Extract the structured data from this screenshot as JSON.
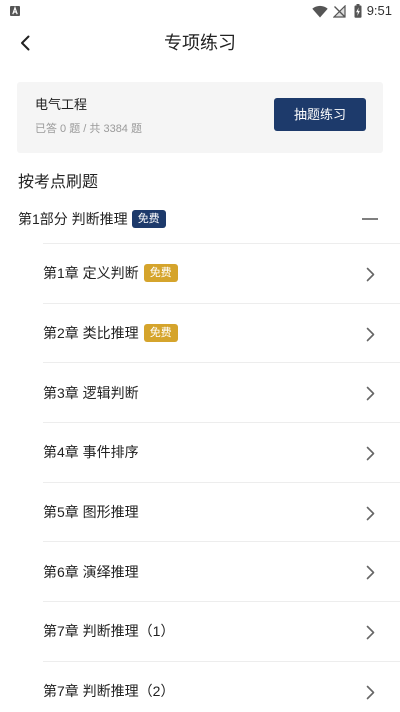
{
  "status_bar": {
    "time": "9:51",
    "icons": [
      "app-notification-icon",
      "wifi-icon",
      "signal-no-service-icon",
      "battery-charging-icon"
    ]
  },
  "header": {
    "title": "专项练习",
    "back_icon": "back-arrow-icon"
  },
  "subject_card": {
    "subject_name": "电气工程",
    "progress_text": "已答 0 题 / 共 3384 题",
    "random_practice_label": "抽题练习"
  },
  "section": {
    "title": "按考点刷题"
  },
  "part": {
    "title": "第1部分 判断推理",
    "badge": "免费",
    "expanded": true,
    "toggle_icon": "collapse-minus-icon",
    "chapter_icon": "chevron-right-icon",
    "chapters": [
      {
        "title": "第1章 定义判断",
        "badge": "免费"
      },
      {
        "title": "第2章 类比推理",
        "badge": "免费"
      },
      {
        "title": "第3章 逻辑判断"
      },
      {
        "title": "第4章 事件排序"
      },
      {
        "title": "第5章 图形推理"
      },
      {
        "title": "第6章 演绎推理"
      },
      {
        "title": "第7章 判断推理（1）"
      },
      {
        "title": "第7章 判断推理（2）"
      }
    ]
  },
  "colors": {
    "accent_navy": "#1d3a6b",
    "badge_gold": "#d5a42c",
    "card_background": "#f5f5f5",
    "text_primary": "#222222",
    "text_secondary": "#9a9a9a",
    "divider": "#ededed"
  }
}
